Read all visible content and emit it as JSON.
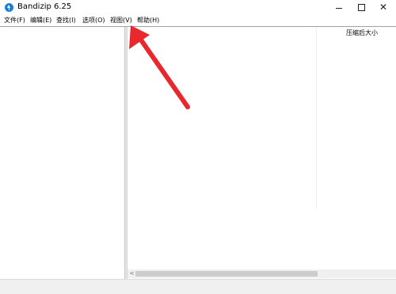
{
  "window": {
    "title": "Bandizip 6.25"
  },
  "menu": [
    {
      "label": "文件(F)"
    },
    {
      "label": "编辑(E)"
    },
    {
      "label": "查找(I)"
    },
    {
      "label": "选项(O)"
    },
    {
      "label": "视图(V)"
    },
    {
      "label": "帮助(H)"
    }
  ],
  "list": {
    "columns": [
      {
        "label": "压缩后大小"
      }
    ]
  },
  "icons": {
    "app": "bandizip-logo-icon",
    "minimize": "minimize-icon",
    "maximize": "maximize-icon",
    "close": "close-icon",
    "scroll_left": "chevron-left-icon",
    "annotation": "red-arrow-icon"
  },
  "colors": {
    "annotation": "#e8282c",
    "logo": "#1a7fd4"
  }
}
